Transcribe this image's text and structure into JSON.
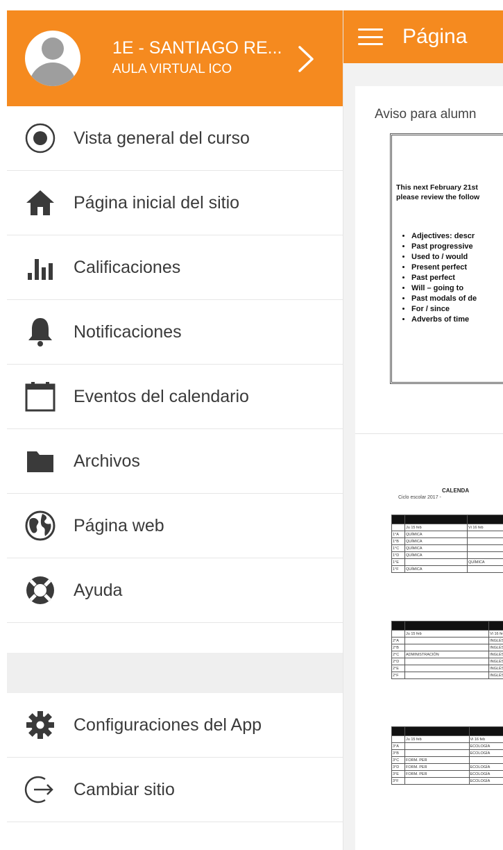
{
  "topbar": {
    "title": "Página"
  },
  "drawer": {
    "course_name": "1E - SANTIAGO RE...",
    "site_name": "AULA VIRTUAL ICO",
    "items": [
      {
        "label": "Vista general del curso",
        "icon": "course-overview-icon"
      },
      {
        "label": "Página inicial del sitio",
        "icon": "home-icon"
      },
      {
        "label": "Calificaciones",
        "icon": "grades-chart-icon"
      },
      {
        "label": "Notificaciones",
        "icon": "bell-icon"
      },
      {
        "label": "Eventos del calendario",
        "icon": "calendar-icon"
      },
      {
        "label": "Archivos",
        "icon": "folder-icon"
      },
      {
        "label": "Página web",
        "icon": "globe-icon"
      },
      {
        "label": "Ayuda",
        "icon": "lifebuoy-icon"
      }
    ],
    "settings_label": "Configuraciones del App",
    "switch_site_label": "Cambiar sitio"
  },
  "content": {
    "aviso": "Aviso para alumn",
    "notice": {
      "line1": "This next February 21st",
      "line2": "please review the follow",
      "topics": [
        "Adjectives: descr",
        "Past progressive",
        "Used to / would",
        "Present perfect",
        "Past perfect",
        "Will – going to",
        "Past modals of de",
        "For / since",
        "Adverbs of time"
      ]
    },
    "calendar": {
      "title": "CALENDA",
      "subtitle": "Ciclo escolar 2017 -",
      "blocks": [
        {
          "headers": [
            "Ju 15 feb",
            "Vi 16 feb"
          ],
          "rows": [
            [
              "1°A",
              "QUÍMICA",
              ""
            ],
            [
              "1°B",
              "QUÍMICA",
              ""
            ],
            [
              "1°C",
              "QUÍMICA",
              ""
            ],
            [
              "1°D",
              "QUÍMICA",
              ""
            ],
            [
              "1°E",
              "",
              "QUÍMICA"
            ],
            [
              "1°F",
              "QUÍMICA",
              ""
            ]
          ]
        },
        {
          "headers": [
            "Ju 15 feb",
            "Vi 16 feb"
          ],
          "rows": [
            [
              "2°A",
              "",
              "INGLÉS"
            ],
            [
              "2°B",
              "",
              "INGLÉS"
            ],
            [
              "2°C",
              "ADMINISTRACIÓN",
              "INGLÉS"
            ],
            [
              "2°D",
              "",
              "INGLÉS"
            ],
            [
              "2°E",
              "",
              "INGLÉS"
            ],
            [
              "2°F",
              "",
              "INGLÉS"
            ]
          ]
        },
        {
          "headers": [
            "Ju 15 feb",
            "Vi 16 feb"
          ],
          "rows": [
            [
              "3°A",
              "",
              "ECOLOGÍA"
            ],
            [
              "3°B",
              "",
              "ECOLOGÍA"
            ],
            [
              "3°C",
              "FORM. PER",
              ""
            ],
            [
              "3°D",
              "FORM. PER",
              "ECOLOGÍA"
            ],
            [
              "3°E",
              "FORM. PER",
              "ECOLOGÍA"
            ],
            [
              "3°F",
              "",
              "ECOLOGÍA"
            ]
          ]
        }
      ]
    }
  },
  "colors": {
    "accent": "#f58a1f"
  }
}
